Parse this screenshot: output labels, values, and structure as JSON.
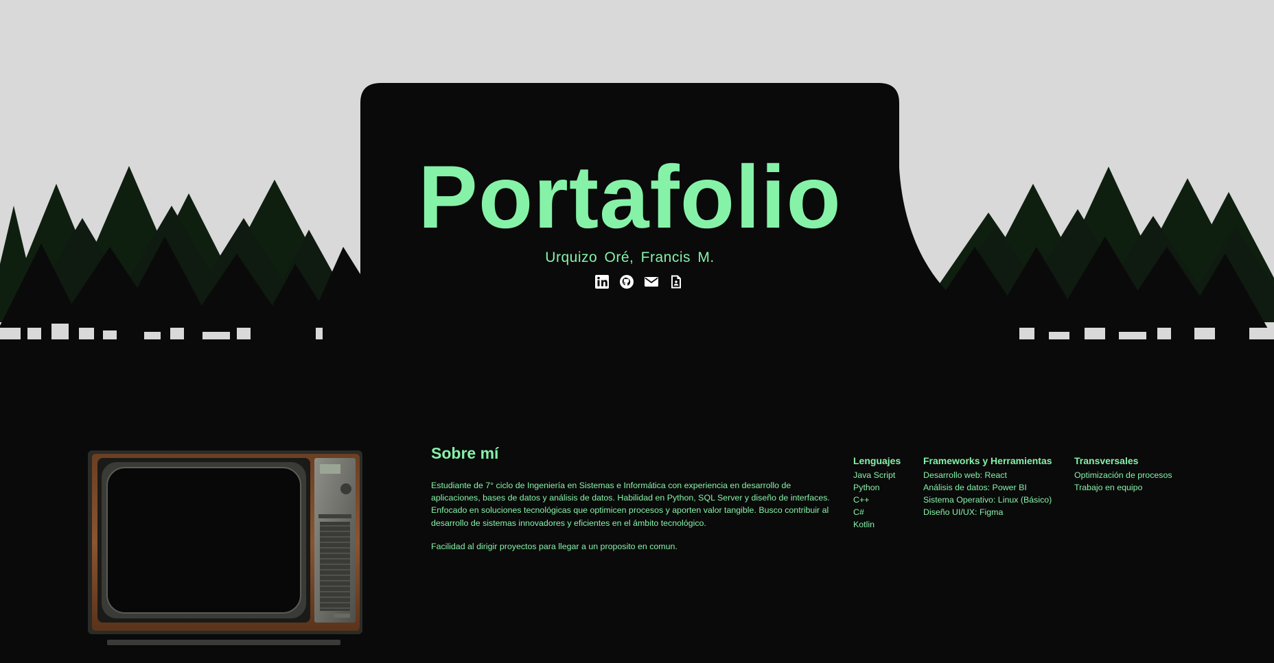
{
  "colors": {
    "accent": "#86f2a8",
    "sky": "#d9d9d9",
    "background": "#0a0a0a",
    "tree_dark": "#0e1f10",
    "tree_black": "#0a0a0a"
  },
  "hero": {
    "title": "Portafolio",
    "subtitle": "Urquizo Oré,  Francis M.",
    "socials": [
      {
        "icon": "linkedin-icon"
      },
      {
        "icon": "github-icon"
      },
      {
        "icon": "mail-icon"
      },
      {
        "icon": "cv-document-icon"
      }
    ]
  },
  "about": {
    "heading": "Sobre mí",
    "paragraph1": "Estudiante de 7° ciclo de Ingeniería en Sistemas e Informática con experiencia en desarrollo de aplicaciones, bases de datos y análisis de datos. Habilidad en Python, SQL Server y diseño de interfaces. Enfocado en soluciones tecnológicas que optimicen procesos y aporten valor tangible. Busco contribuir al desarrollo de sistemas innovadores y eficientes en el ámbito tecnológico.",
    "paragraph2": "Facilidad al dirigir proyectos para llegar a un proposito en comun."
  },
  "skills": [
    {
      "title": "Lenguajes",
      "items": [
        "Java Script",
        "Python",
        "C++",
        "C#",
        "Kotlin"
      ]
    },
    {
      "title": "Frameworks y Herramientas",
      "items": [
        "Desarrollo web: React",
        "Análisis de datos: Power BI",
        "Sistema Operativo: Linux (Básico)",
        "Diseño UI/UX: Figma"
      ]
    },
    {
      "title": "Transversales",
      "items": [
        "Optimización de procesos",
        "Trabajo en equipo"
      ]
    }
  ]
}
